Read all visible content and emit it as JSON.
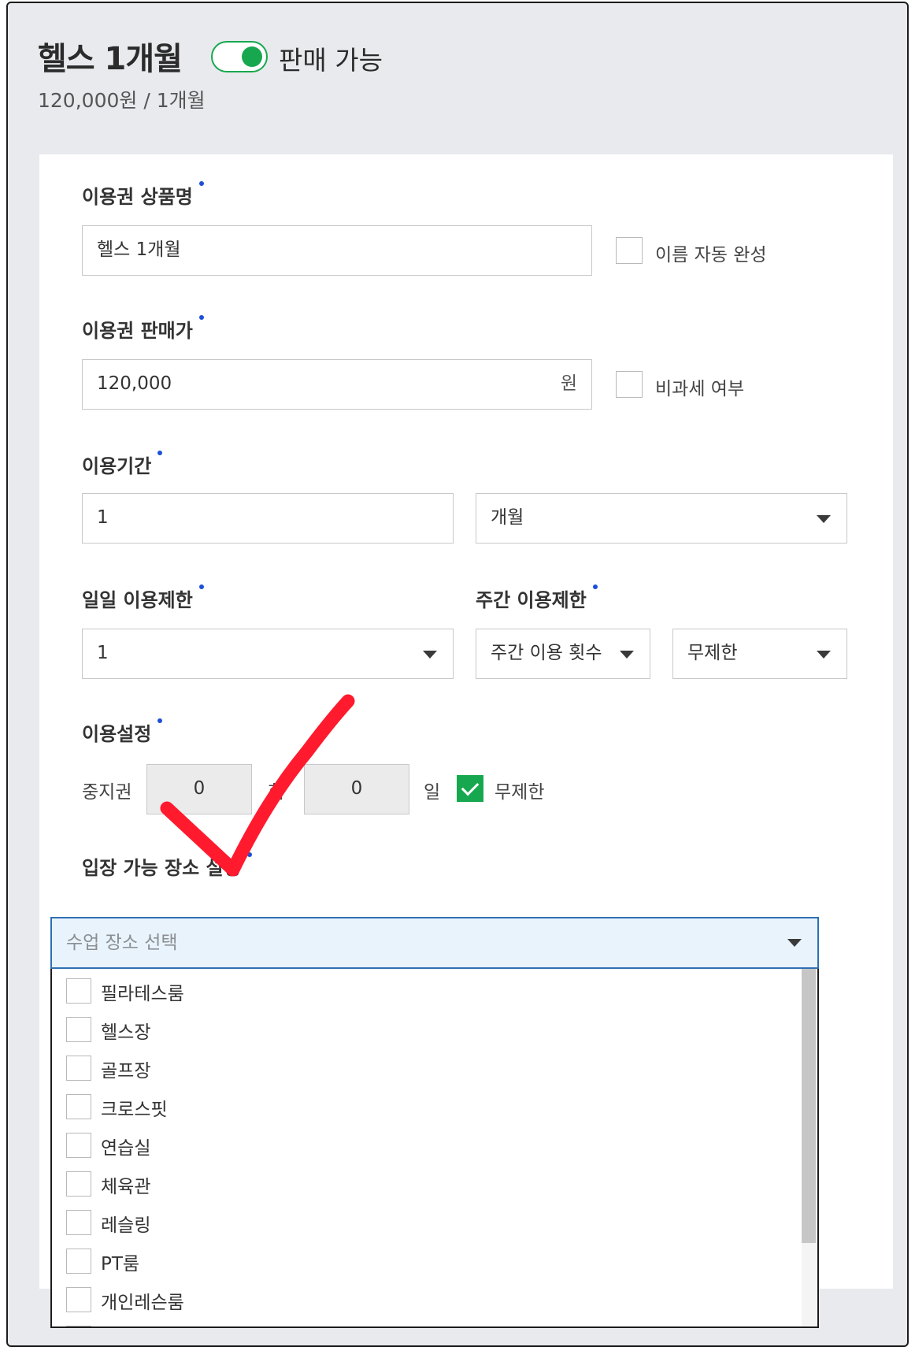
{
  "header": {
    "title": "헬스 1개월",
    "toggle_on": true,
    "toggle_label": "판매 가능",
    "subtitle": "120,000원 / 1개월"
  },
  "colors": {
    "accent_green": "#17a84f",
    "required_dot": "#1d4fd8",
    "annotation_red": "#ff1a2e"
  },
  "form": {
    "name": {
      "label": "이용권 상품명",
      "value": "헬스 1개월",
      "autocomplete_label": "이름 자동 완성",
      "autocomplete_checked": false
    },
    "price": {
      "label": "이용권 판매가",
      "value": "120,000",
      "unit": "원",
      "taxfree_label": "비과세 여부",
      "taxfree_checked": false
    },
    "period": {
      "label": "이용기간",
      "value": "1",
      "unit_selected": "개월"
    },
    "daily_limit": {
      "label": "일일 이용제한",
      "selected": "1"
    },
    "weekly_limit": {
      "label": "주간 이용제한",
      "type_selected": "주간 이용 횟수",
      "value_selected": "무제한"
    },
    "usage_settings": {
      "label": "이용설정",
      "pause_label": "중지권",
      "pause_count": "0",
      "count_unit": "회",
      "pause_days": "0",
      "day_unit": "일",
      "unlimited_label": "무제한",
      "unlimited_checked": true
    },
    "location": {
      "label": "입장 가능 장소 설정",
      "placeholder": "수업 장소 선택",
      "options": [
        "필라테스룸",
        "헬스장",
        "골프장",
        "크로스핏",
        "연습실",
        "체육관",
        "레슬링",
        "PT룸",
        "개인레슨룸"
      ]
    }
  }
}
